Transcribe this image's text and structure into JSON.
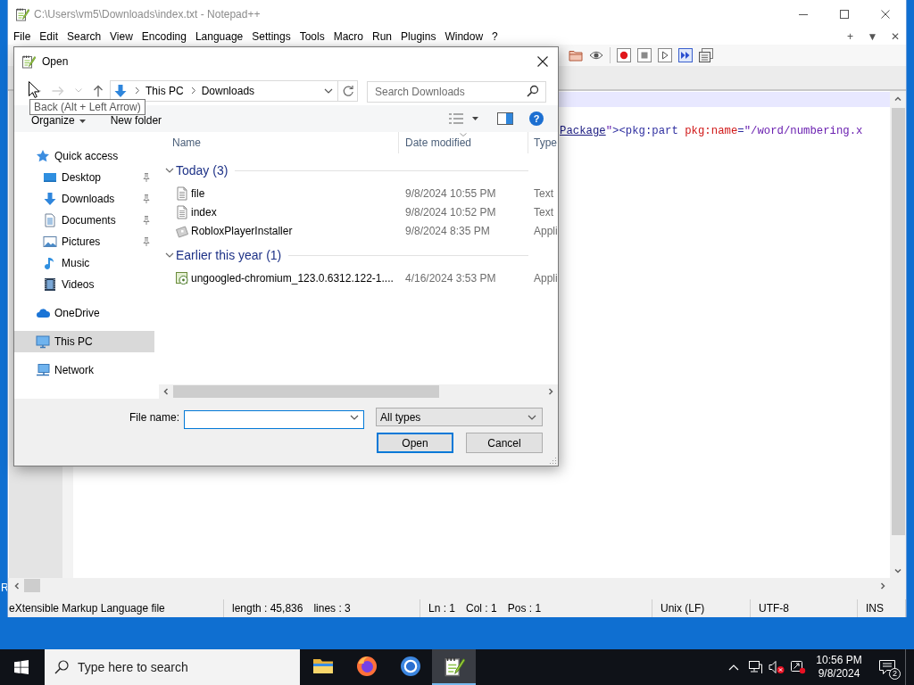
{
  "desktop": {
    "label_fragment": "R"
  },
  "editor_window": {
    "title": "C:\\Users\\vm5\\Downloads\\index.txt - Notepad++",
    "menu": [
      "File",
      "Edit",
      "Search",
      "View",
      "Encoding",
      "Language",
      "Settings",
      "Tools",
      "Macro",
      "Run",
      "Plugins",
      "Window",
      "?"
    ],
    "menu_controls": [
      "+",
      "▼",
      "✕"
    ],
    "line": [
      {
        "kind": "link",
        "text": "Package"
      },
      {
        "kind": "value",
        "text": "\""
      },
      {
        "kind": "tag",
        "text": "><pkg:part "
      },
      {
        "kind": "attr",
        "text": "pkg:name"
      },
      {
        "kind": "tag",
        "text": "="
      },
      {
        "kind": "value",
        "text": "\"/word/numbering.x"
      }
    ],
    "status_bar": [
      [
        "eXtensible Markup Language file"
      ],
      [
        "length : 45,836",
        "lines : 3"
      ],
      [
        "Ln : 1",
        "Col : 1",
        "Pos : 1"
      ],
      [
        "Unix (LF)"
      ],
      [
        "UTF-8"
      ],
      [
        "INS"
      ]
    ]
  },
  "dialog": {
    "title": "Open",
    "breadcrumb": [
      "This PC",
      "Downloads"
    ],
    "search": {
      "placeholder": "Search Downloads"
    },
    "tooltip": "Back (Alt + Left Arrow)",
    "commands": [
      {
        "label": "Organize",
        "menu": true
      },
      {
        "label": "New folder",
        "menu": false
      }
    ],
    "help": "?",
    "nav": [
      {
        "label": "Quick access",
        "selected": false,
        "children": [
          {
            "label": "Desktop",
            "pinned": true,
            "selected": false
          },
          {
            "label": "Downloads",
            "pinned": true,
            "selected": false
          },
          {
            "label": "Documents",
            "pinned": true,
            "selected": false
          },
          {
            "label": "Pictures",
            "pinned": true,
            "selected": false
          },
          {
            "label": "Music",
            "pinned": false,
            "selected": false
          },
          {
            "label": "Videos",
            "pinned": false,
            "selected": false
          }
        ]
      },
      {
        "label": "OneDrive",
        "selected": false
      },
      {
        "label": "This PC",
        "selected": true
      },
      {
        "label": "Network",
        "selected": false
      }
    ],
    "columns": [
      "Name",
      "Date modified",
      "Type"
    ],
    "groups": [
      {
        "label": "Today (3)",
        "expanded": true,
        "files": [
          {
            "kind": "text",
            "name": "file",
            "date": "9/8/2024 10:55 PM",
            "type": "Text"
          },
          {
            "kind": "text",
            "name": "index",
            "date": "9/8/2024 10:52 PM",
            "type": "Text"
          },
          {
            "kind": "app",
            "name": "RobloxPlayerInstaller",
            "date": "9/8/2024 8:35 PM",
            "type": "Appli"
          }
        ]
      },
      {
        "label": "Earlier this year (1)",
        "expanded": true,
        "files": [
          {
            "kind": "setup",
            "name": "ungoogled-chromium_123.0.6312.122-1....",
            "date": "4/16/2024 3:53 PM",
            "type": "Appli"
          }
        ]
      }
    ],
    "file_name": {
      "label": "File name:"
    },
    "filter": "All types",
    "buttons": [
      {
        "label": "Open",
        "default": true
      },
      {
        "label": "Cancel",
        "default": false
      }
    ]
  },
  "taskbar": {
    "search": {
      "placeholder": "Type here to search"
    },
    "apps": [
      {
        "active": false
      },
      {
        "active": false
      },
      {
        "active": false
      },
      {
        "active": true
      }
    ],
    "clock": {
      "time": "10:56 PM",
      "date": "9/8/2024"
    },
    "notifications": "2"
  }
}
